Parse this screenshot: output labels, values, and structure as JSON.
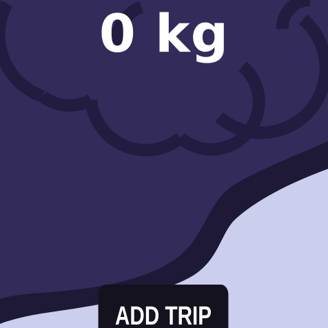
{
  "colors": {
    "background": "#332b5a",
    "cloud_outline": "#221c40",
    "wave_dark": "#1e1936",
    "wave_light": "#ccceee",
    "button_bg": "#14121f",
    "text": "#ffffff"
  },
  "header": {
    "total_value": "0 kg"
  },
  "actions": {
    "add_trip_label": "ADD TRIP"
  },
  "icons": {
    "background": "cloud-icon"
  }
}
